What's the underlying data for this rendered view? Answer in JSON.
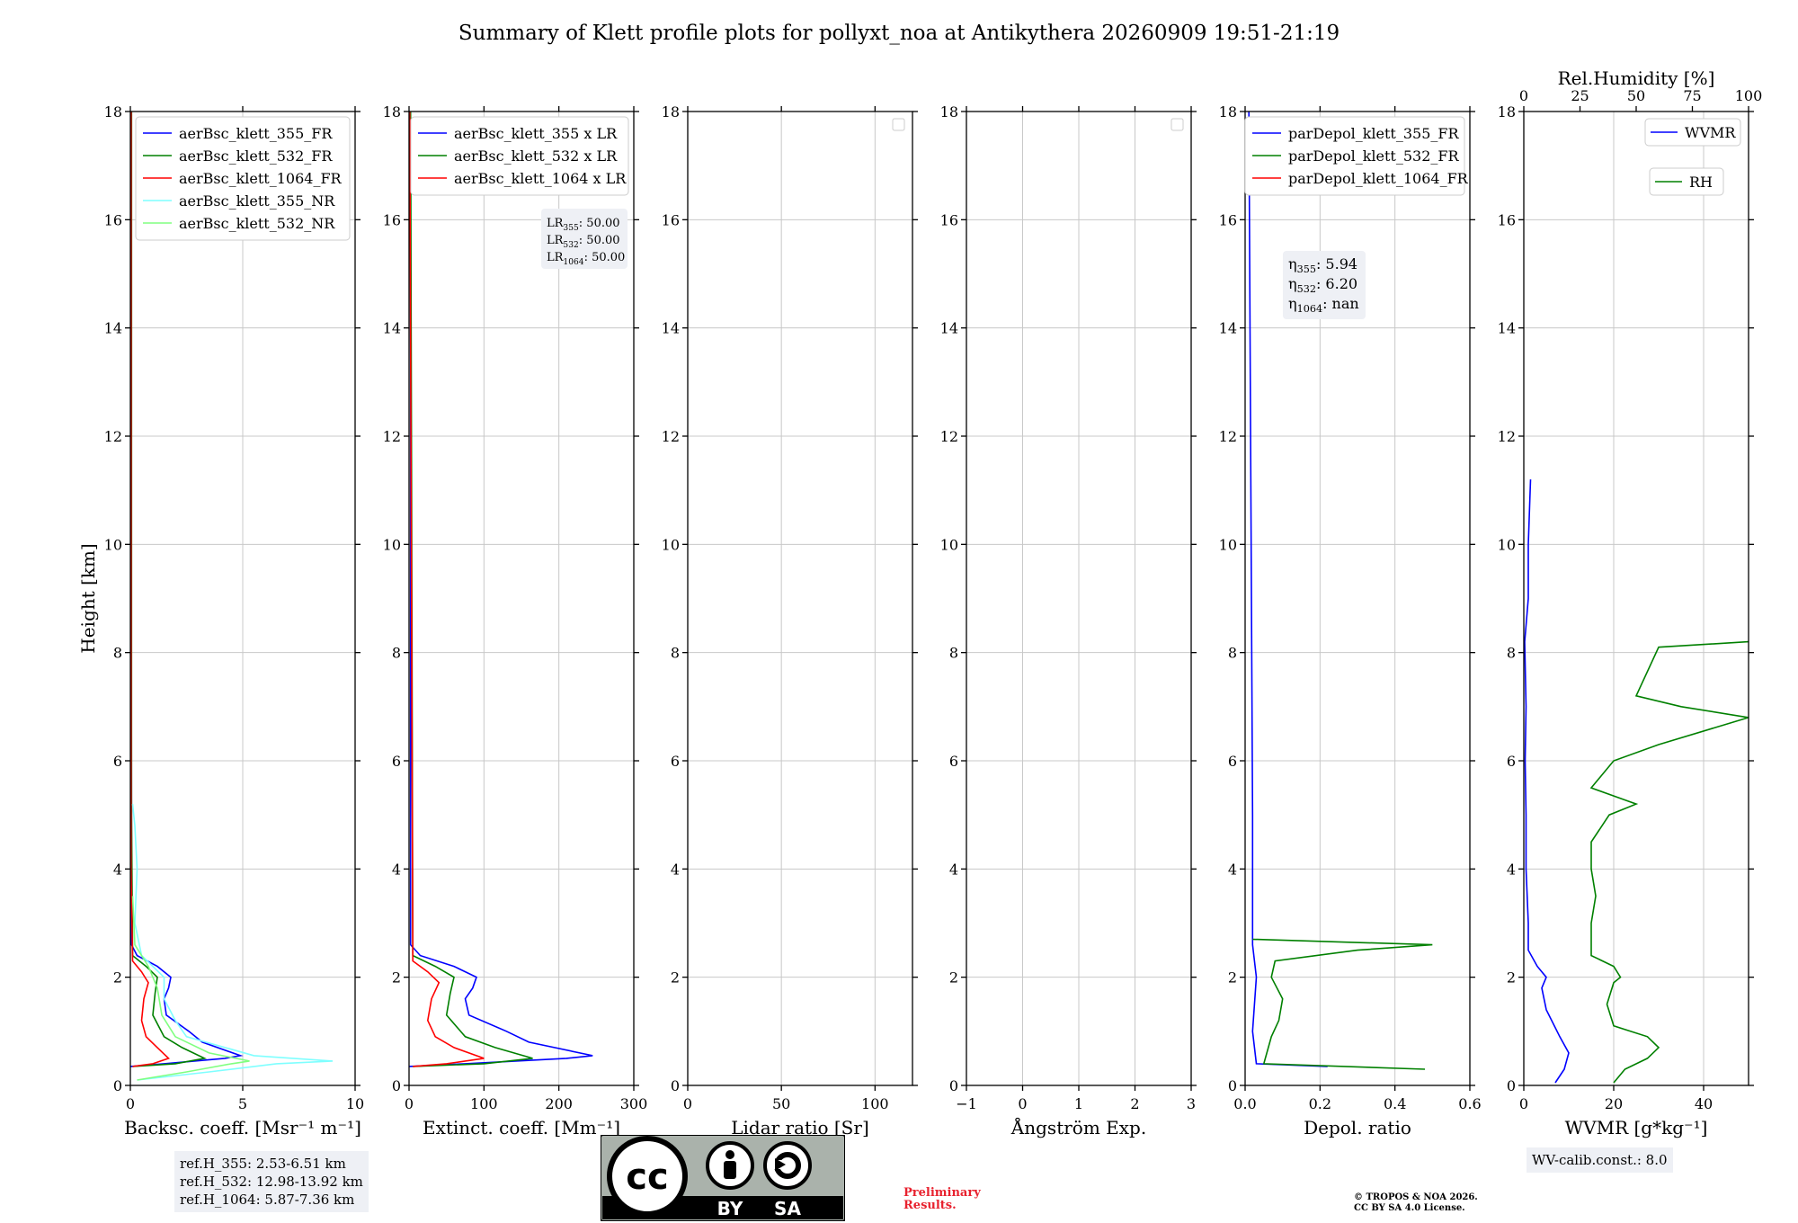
{
  "title": "Summary of Klett profile plots for pollyxt_noa at Antikythera 20260909 19:51-21:19",
  "colors": {
    "blue": "#0000ff",
    "green": "#008000",
    "red": "#ff0000",
    "cyan": "#7fffff",
    "lightgreen": "#80ff80",
    "gridline": "#c8c8c8",
    "box_bg": "#eef0f5"
  },
  "chart_data": [
    {
      "type": "line",
      "id": "backscatter",
      "xlabel": "Backsc. coeff. [Msr⁻¹ m⁻¹]",
      "ylabel": "Height [km]",
      "xlim": [
        0,
        10
      ],
      "ylim": [
        0,
        18
      ],
      "xticks": [
        "0",
        "5",
        "10"
      ],
      "yticks": [
        "0",
        "2",
        "4",
        "6",
        "8",
        "10",
        "12",
        "14",
        "16",
        "18"
      ],
      "grid": true,
      "legend_position": "top-right",
      "series": [
        {
          "name": "aerBsc_klett_355_FR",
          "color": "#0000ff",
          "points": [
            [
              0,
              0.35
            ],
            [
              1.5,
              0.4
            ],
            [
              4.2,
              0.5
            ],
            [
              4.9,
              0.55
            ],
            [
              3.2,
              0.8
            ],
            [
              2.6,
              1.0
            ],
            [
              1.6,
              1.3
            ],
            [
              1.5,
              1.6
            ],
            [
              1.7,
              1.8
            ],
            [
              1.8,
              2.0
            ],
            [
              1.2,
              2.2
            ],
            [
              0.3,
              2.4
            ],
            [
              0.05,
              2.6
            ],
            [
              0.05,
              5
            ],
            [
              0.02,
              18
            ]
          ]
        },
        {
          "name": "aerBsc_klett_532_FR",
          "color": "#008000",
          "points": [
            [
              0.1,
              0.35
            ],
            [
              2.0,
              0.4
            ],
            [
              3.3,
              0.5
            ],
            [
              2.3,
              0.7
            ],
            [
              1.5,
              0.9
            ],
            [
              1.0,
              1.3
            ],
            [
              1.1,
              1.7
            ],
            [
              1.2,
              2.0
            ],
            [
              0.7,
              2.2
            ],
            [
              0.1,
              2.4
            ],
            [
              0.05,
              5
            ],
            [
              0.05,
              12
            ],
            [
              0.05,
              18
            ]
          ]
        },
        {
          "name": "aerBsc_klett_1064_FR",
          "color": "#ff0000",
          "points": [
            [
              0.1,
              0.35
            ],
            [
              1.0,
              0.4
            ],
            [
              1.7,
              0.5
            ],
            [
              1.2,
              0.7
            ],
            [
              0.7,
              0.9
            ],
            [
              0.5,
              1.2
            ],
            [
              0.6,
              1.6
            ],
            [
              0.8,
              1.9
            ],
            [
              0.5,
              2.1
            ],
            [
              0.1,
              2.3
            ],
            [
              0.03,
              4
            ],
            [
              0.03,
              18
            ]
          ]
        },
        {
          "name": "aerBsc_klett_355_NR",
          "color": "#7fffff",
          "points": [
            [
              0.3,
              0.1
            ],
            [
              3.5,
              0.25
            ],
            [
              6.5,
              0.4
            ],
            [
              9.0,
              0.45
            ],
            [
              5.5,
              0.55
            ],
            [
              2.5,
              0.9
            ],
            [
              2.0,
              1.2
            ],
            [
              1.5,
              1.6
            ],
            [
              1.5,
              2.0
            ],
            [
              0.5,
              2.4
            ],
            [
              0.2,
              3.0
            ],
            [
              0.3,
              4.0
            ],
            [
              0.2,
              4.8
            ],
            [
              0.1,
              5.2
            ]
          ]
        },
        {
          "name": "aerBsc_klett_532_NR",
          "color": "#80ff80",
          "points": [
            [
              0.3,
              0.1
            ],
            [
              2.5,
              0.25
            ],
            [
              4.5,
              0.4
            ],
            [
              5.3,
              0.45
            ],
            [
              3.5,
              0.6
            ],
            [
              2.0,
              0.9
            ],
            [
              1.4,
              1.3
            ],
            [
              1.2,
              1.8
            ],
            [
              0.8,
              2.2
            ],
            [
              0.2,
              2.6
            ],
            [
              0.1,
              3.5
            ]
          ]
        }
      ]
    },
    {
      "type": "line",
      "id": "extinction",
      "xlabel": "Extinct. coeff. [Mm⁻¹]",
      "ylabel": "",
      "xlim": [
        0,
        300
      ],
      "ylim": [
        0,
        18
      ],
      "xticks": [
        "0",
        "100",
        "200",
        "300"
      ],
      "yticks": [
        "0",
        "2",
        "4",
        "6",
        "8",
        "10",
        "12",
        "14",
        "16",
        "18"
      ],
      "grid": true,
      "legend_position": "top-right",
      "series": [
        {
          "name": "aerBsc_klett_355 x LR",
          "color": "#0000ff",
          "points": [
            [
              0,
              0.35
            ],
            [
              75,
              0.4
            ],
            [
              210,
              0.5
            ],
            [
              245,
              0.55
            ],
            [
              160,
              0.8
            ],
            [
              130,
              1.0
            ],
            [
              80,
              1.3
            ],
            [
              75,
              1.6
            ],
            [
              85,
              1.8
            ],
            [
              90,
              2.0
            ],
            [
              60,
              2.2
            ],
            [
              15,
              2.4
            ],
            [
              2,
              2.6
            ],
            [
              2,
              18
            ]
          ]
        },
        {
          "name": "aerBsc_klett_532 x LR",
          "color": "#008000",
          "points": [
            [
              5,
              0.35
            ],
            [
              100,
              0.4
            ],
            [
              165,
              0.5
            ],
            [
              115,
              0.7
            ],
            [
              75,
              0.9
            ],
            [
              50,
              1.3
            ],
            [
              55,
              1.7
            ],
            [
              60,
              2.0
            ],
            [
              35,
              2.2
            ],
            [
              5,
              2.4
            ],
            [
              2,
              18
            ]
          ]
        },
        {
          "name": "aerBsc_klett_1064 x LR",
          "color": "#ff0000",
          "points": [
            [
              5,
              0.35
            ],
            [
              50,
              0.4
            ],
            [
              100,
              0.5
            ],
            [
              60,
              0.7
            ],
            [
              35,
              0.9
            ],
            [
              25,
              1.2
            ],
            [
              30,
              1.6
            ],
            [
              40,
              1.9
            ],
            [
              25,
              2.1
            ],
            [
              5,
              2.3
            ],
            [
              1,
              18
            ]
          ]
        }
      ]
    },
    {
      "type": "line",
      "id": "lidar_ratio",
      "xlabel": "Lidar ratio [Sr]",
      "ylabel": "",
      "xlim": [
        0,
        120
      ],
      "ylim": [
        0,
        18
      ],
      "xticks": [
        "0",
        "50",
        "100"
      ],
      "yticks": [
        "0",
        "2",
        "4",
        "6",
        "8",
        "10",
        "12",
        "14",
        "16",
        "18"
      ],
      "grid": true,
      "series": []
    },
    {
      "type": "line",
      "id": "angstrom",
      "xlabel": "Ångström Exp.",
      "ylabel": "",
      "xlim": [
        -1,
        3
      ],
      "ylim": [
        0,
        18
      ],
      "xticks": [
        "−1",
        "0",
        "1",
        "2",
        "3"
      ],
      "yticks": [
        "0",
        "2",
        "4",
        "6",
        "8",
        "10",
        "12",
        "14",
        "16",
        "18"
      ],
      "grid": true,
      "series": []
    },
    {
      "type": "line",
      "id": "depol",
      "xlabel": "Depol. ratio",
      "ylabel": "",
      "xlim": [
        0,
        0.6
      ],
      "ylim": [
        0,
        18
      ],
      "xticks": [
        "0.0",
        "0.2",
        "0.4",
        "0.6"
      ],
      "yticks": [
        "0",
        "2",
        "4",
        "6",
        "8",
        "10",
        "12",
        "14",
        "16",
        "18"
      ],
      "grid": true,
      "legend_position": "top-right",
      "series": [
        {
          "name": "parDepol_klett_355_FR",
          "color": "#0000ff",
          "points": [
            [
              0.22,
              0.35
            ],
            [
              0.03,
              0.4
            ],
            [
              0.02,
              1.0
            ],
            [
              0.03,
              2.0
            ],
            [
              0.02,
              2.6
            ],
            [
              0.02,
              5
            ],
            [
              0.01,
              18
            ]
          ]
        },
        {
          "name": "parDepol_klett_532_FR",
          "color": "#008000",
          "points": [
            [
              0.48,
              0.3
            ],
            [
              0.05,
              0.4
            ],
            [
              0.07,
              0.9
            ],
            [
              0.09,
              1.2
            ],
            [
              0.1,
              1.6
            ],
            [
              0.07,
              2.0
            ],
            [
              0.08,
              2.3
            ],
            [
              0.3,
              2.5
            ],
            [
              0.5,
              2.6
            ],
            [
              0.02,
              2.7
            ]
          ]
        },
        {
          "name": "parDepol_klett_1064_FR",
          "color": "#ff0000",
          "points": []
        }
      ]
    },
    {
      "type": "line",
      "id": "wvmr",
      "xlabel": "WVMR [g*kg⁻¹]",
      "ylabel": "",
      "xlim": [
        0,
        50
      ],
      "ylim": [
        0,
        18
      ],
      "xticks": [
        "0",
        "20",
        "40"
      ],
      "yticks": [
        "0",
        "2",
        "4",
        "6",
        "8",
        "10",
        "12",
        "14",
        "16",
        "18"
      ],
      "top_axis": {
        "label": "Rel.Humidity [%]",
        "lim": [
          0,
          100
        ],
        "ticks": [
          "0",
          "25",
          "50",
          "75",
          "100"
        ]
      },
      "grid": true,
      "legend_position": "top-right",
      "series": [
        {
          "name": "WVMR",
          "color": "#0000ff",
          "points": [
            [
              7,
              0.05
            ],
            [
              9,
              0.3
            ],
            [
              10,
              0.6
            ],
            [
              8,
              0.9
            ],
            [
              5,
              1.4
            ],
            [
              4,
              1.8
            ],
            [
              5,
              2.0
            ],
            [
              3,
              2.2
            ],
            [
              1,
              2.5
            ],
            [
              1,
              3
            ],
            [
              0.5,
              4
            ],
            [
              0.5,
              5
            ],
            [
              0.3,
              6
            ],
            [
              0.5,
              7
            ],
            [
              0.2,
              8.2
            ],
            [
              1,
              9
            ],
            [
              1,
              10
            ],
            [
              1.5,
              11.2
            ]
          ]
        },
        {
          "name": "RH",
          "color": "#008000",
          "points": [
            [
              40,
              0.05
            ],
            [
              45,
              0.3
            ],
            [
              55,
              0.5
            ],
            [
              60,
              0.7
            ],
            [
              55,
              0.9
            ],
            [
              40,
              1.1
            ],
            [
              37,
              1.5
            ],
            [
              40,
              1.9
            ],
            [
              43,
              2.0
            ],
            [
              40,
              2.2
            ],
            [
              30,
              2.4
            ],
            [
              30,
              3
            ],
            [
              32,
              3.5
            ],
            [
              30,
              4
            ],
            [
              30,
              4.5
            ],
            [
              38,
              5
            ],
            [
              50,
              5.2
            ],
            [
              30,
              5.5
            ],
            [
              40,
              6
            ],
            [
              60,
              6.3
            ],
            [
              100,
              6.8
            ],
            [
              70,
              7
            ],
            [
              50,
              7.2
            ],
            [
              60,
              8.1
            ],
            [
              100,
              8.2
            ]
          ]
        }
      ]
    }
  ],
  "info_boxes": {
    "lr": [
      {
        "sym": "LR",
        "sub": "355",
        "val": ": 50.00"
      },
      {
        "sym": "LR",
        "sub": "532",
        "val": ": 50.00"
      },
      {
        "sym": "LR",
        "sub": "1064",
        "val": ": 50.00"
      }
    ],
    "eta": [
      {
        "sym": "η",
        "sub": "355",
        "val": ": 5.94"
      },
      {
        "sym": "η",
        "sub": "532",
        "val": ": 6.20"
      },
      {
        "sym": "η",
        "sub": "1064",
        "val": ": nan"
      }
    ],
    "ref_h": [
      "ref.H_355: 2.53-6.51 km",
      "ref.H_532: 12.98-13.92 km",
      "ref.H_1064: 5.87-7.36 km"
    ],
    "wv_calib": "WV-calib.const.: 8.0"
  },
  "logo": {
    "letters": "cc",
    "by": "BY",
    "sa": "SA"
  },
  "footer": {
    "preliminary": "Preliminary Results.",
    "copyright_line1": "© TROPOS & NOA 2026.",
    "copyright_line2": "CC BY SA 4.0 License."
  }
}
